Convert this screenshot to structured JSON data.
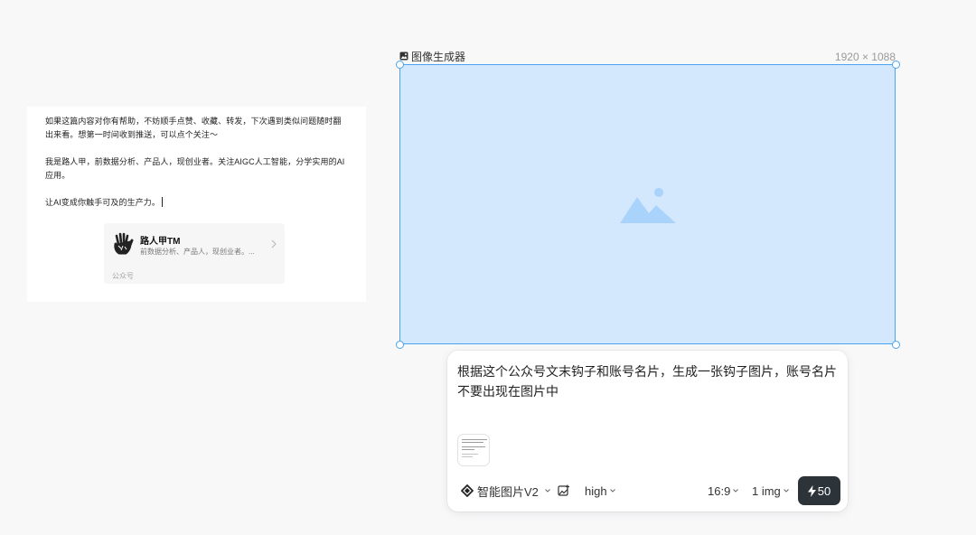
{
  "document": {
    "paragraphs": [
      "如果这篇内容对你有帮助，不妨顺手点赞、收藏、转发，下次遇到类似问题随时翻出来看。想第一时间收到推送，可以点个关注～",
      "我是路人甲，前数据分析、产品人，现创业者。关注AIGC人工智能，分学实用的AI应用。",
      "让AI变成你触手可及的生产力。"
    ],
    "account_card": {
      "name": "路人甲TM",
      "description": "前数据分析、产品人，现创业者。...",
      "type": "公众号"
    }
  },
  "generator": {
    "label": "图像生成器",
    "size": "1920 × 1088",
    "frame_color": "#d4e8fd",
    "border_color": "#4aa3f0"
  },
  "prompt": {
    "text": "根据这个公众号文末钩子和账号名片，生成一张钩子图片，账号名片不要出现在图片中",
    "model": "智能图片V2",
    "quality": "high",
    "ratio": "16:9",
    "count": "1 img",
    "cost": "50",
    "button_color": "#2c3339"
  }
}
